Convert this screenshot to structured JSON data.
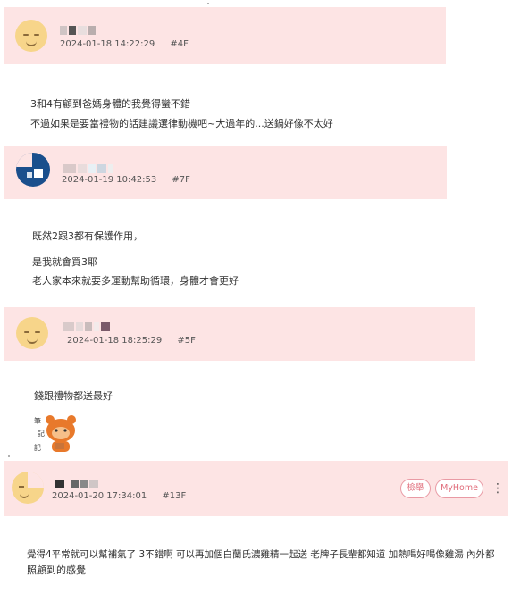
{
  "posts": [
    {
      "timestamp": "2024-01-18 14:22:29",
      "floor": "#4F",
      "avatar": "smile-face-avatar",
      "lines": [
        "3和4有顧到爸媽身體的我覺得蠻不錯",
        "不過如果是要當禮物的話建議選律動機吧~大過年的...送鍋好像不太好"
      ]
    },
    {
      "timestamp": "2024-01-19 10:42:53",
      "floor": "#7F",
      "avatar": "blue-logo-avatar",
      "lines": [
        "既然2跟3都有保護作用，",
        "是我就會買3耶",
        "老人家本來就要多運動幫助循環，身體才會更好"
      ]
    },
    {
      "timestamp": "2024-01-18 18:25:29",
      "floor": "#5F",
      "avatar": "smile-face-avatar",
      "lines": [
        "錢跟禮物都送最好"
      ],
      "sticker": "bear-sticker"
    },
    {
      "timestamp": "2024-01-20 17:34:01",
      "floor": "#13F",
      "avatar": "half-smile-avatar",
      "actions": {
        "report_label": "檢舉",
        "myhome_label": "MyHome",
        "more_icon": "⋮"
      },
      "lines": [
        "覺得4平常就可以幫補氣了 3不錯啊 可以再加個白蘭氏濃雞精一起送 老牌子長輩都知道 加熱喝好喝像雞湯 內外都",
        "照顧到的感覺"
      ]
    }
  ],
  "colors": {
    "header_bg": "#fde4e4",
    "accent": "#e06c7a",
    "avatar_yellow": "#f7d58a",
    "avatar_blue": "#1a4f8c"
  }
}
